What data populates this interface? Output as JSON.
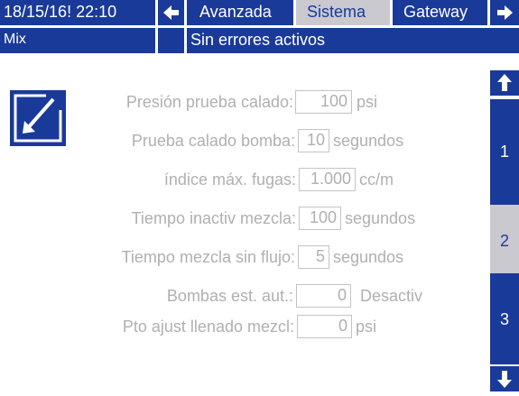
{
  "header": {
    "datetime": "18/15/16! 22:10",
    "tabs": [
      {
        "label": "Avanzada",
        "active": false
      },
      {
        "label": "Sistema",
        "active": true
      },
      {
        "label": "Gateway",
        "active": false
      }
    ],
    "mode": "Mix",
    "status": "Sin errores activos"
  },
  "side_tabs": [
    {
      "label": "1",
      "active": false
    },
    {
      "label": "2",
      "active": true
    },
    {
      "label": "3",
      "active": false
    }
  ],
  "settings": [
    {
      "label": "Presión prueba calado:",
      "value": "100",
      "unit": "psi"
    },
    {
      "label": "Prueba calado bomba:",
      "value": "10",
      "unit": "segundos"
    },
    {
      "label": "índice máx. fugas:",
      "value": "1.000",
      "unit": "cc/m"
    },
    {
      "label": "Tiempo inactiv mezcla:",
      "value": "100",
      "unit": "segundos"
    },
    {
      "label": "Tiempo mezcla sin flujo:",
      "value": "5",
      "unit": "segundos"
    },
    {
      "label": "Bombas est. aut.:",
      "value": "0",
      "unit": "Desactiv"
    },
    {
      "label": "Pto ajust llenado mezcl:",
      "value": "0",
      "unit": "psi"
    }
  ],
  "icons": {
    "edit": "edit-icon",
    "left": "arrow-left-icon",
    "right": "arrow-right-icon",
    "up": "arrow-up-icon",
    "down": "arrow-down-icon"
  },
  "colors": {
    "primary": "#1a3a9a",
    "active_tab": "#c9c9cf",
    "disabled_text": "#b0b0b0"
  }
}
